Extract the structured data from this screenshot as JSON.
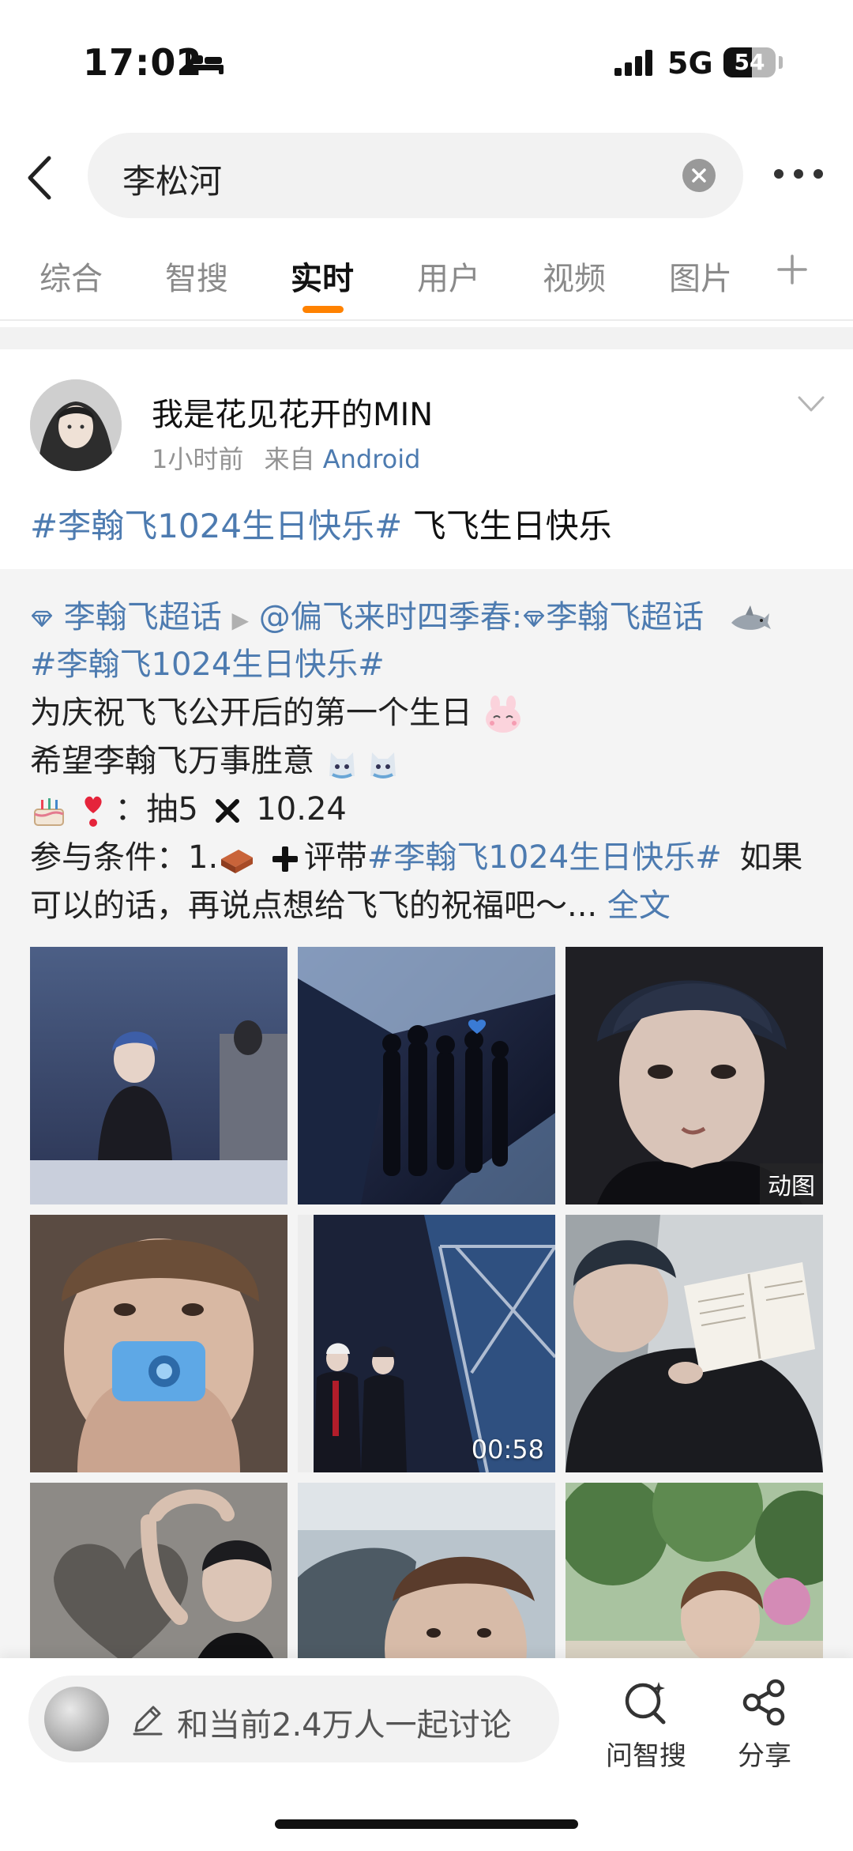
{
  "status_bar": {
    "time": "17:02",
    "network": "5G",
    "battery": "54",
    "battery_level": 0.54
  },
  "search": {
    "query": "李松河"
  },
  "tabs": [
    {
      "label": "综合",
      "active": false
    },
    {
      "label": "智搜",
      "active": false
    },
    {
      "label": "实时",
      "active": true
    },
    {
      "label": "用户",
      "active": false
    },
    {
      "label": "视频",
      "active": false
    },
    {
      "label": "图片",
      "active": false
    }
  ],
  "post": {
    "username": "我是花见花开的MIN",
    "time": "1小时前",
    "from_prefix": "来自",
    "source": "Android",
    "hashtag": "#李翰飞1024生日快乐#",
    "text": "飞飞生日快乐"
  },
  "repost": {
    "supertopic_1": "李翰飞超话",
    "mention": "@偏飞来时四季春:",
    "supertopic_2": "李翰飞超话",
    "hashtag": "#李翰飞1024生日快乐#",
    "line3": "为庆祝飞飞公开后的第一个生日",
    "line4": "希望李翰飞万事胜意",
    "line5": "：抽5",
    "line5_date": "10.24",
    "line6_prefix": "参与条件：1.",
    "line6_mid": "评带",
    "line6_hashtag": "#李翰飞1024生日快乐#",
    "line6_suffix": "如果",
    "line7": "可以的话，再说点想给飞飞的祝福吧～...",
    "full_text": "全文"
  },
  "media": [
    {
      "badge": ""
    },
    {
      "badge": ""
    },
    {
      "badge": "动图"
    },
    {
      "badge": ""
    },
    {
      "badge": "00:58"
    },
    {
      "badge": ""
    },
    {
      "badge": ""
    },
    {
      "badge": ""
    },
    {
      "badge": ""
    }
  ],
  "bottom": {
    "discuss_placeholder": "和当前2.4万人一起讨论",
    "smart_search": "问智搜",
    "share": "分享"
  }
}
